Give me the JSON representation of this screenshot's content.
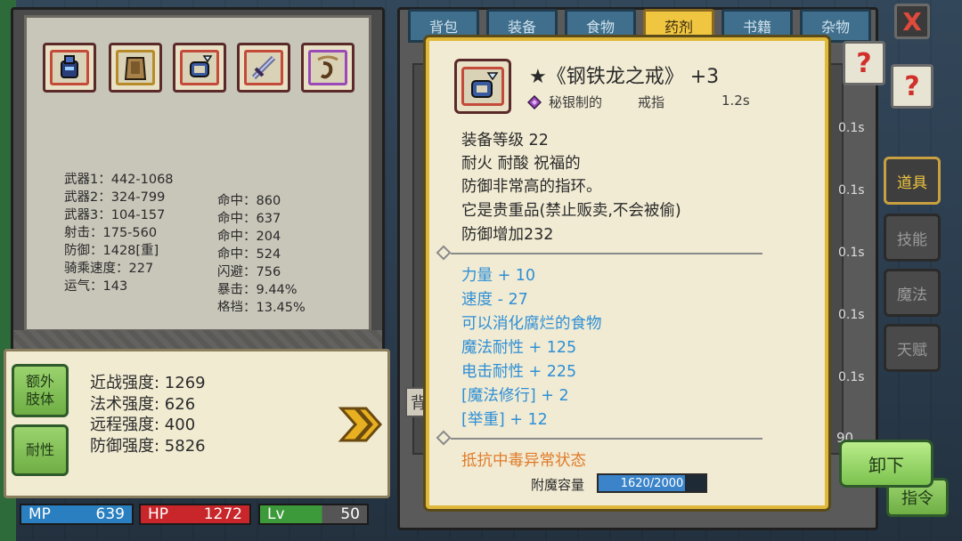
{
  "tabs": [
    "背包",
    "装备",
    "食物",
    "药剂",
    "书籍",
    "杂物"
  ],
  "active_tab": "药剂",
  "right_tabs": [
    "道具",
    "技能",
    "魔法",
    "天赋"
  ],
  "stats_left": [
    "武器1：442-1068",
    "武器2：324-799",
    "武器3：104-157",
    "射击：175-560",
    "防御：1428[重]",
    "骑乘速度：227",
    "运气：143"
  ],
  "stats_right": [
    "命中：860",
    "命中：637",
    "命中：204",
    "命中：524",
    "闪避：756",
    "暴击：9.44%",
    "格挡：13.45%"
  ],
  "summary": {
    "extra_limb_label": "额外\n肢体",
    "resistance_label": "耐性",
    "lines": [
      "近战强度: 1269",
      "法术强度: 626",
      "远程强度: 400",
      "防御强度: 5826"
    ]
  },
  "bars": {
    "mp_label": "MP",
    "mp_value": "639",
    "hp_label": "HP",
    "hp_value": "1272",
    "lv_label": "Lv",
    "lv_value": "50"
  },
  "item": {
    "title": "★《钢铁龙之戒》 +3",
    "material": "秘银制的",
    "type": "戒指",
    "time": "1.2s",
    "description": [
      "装备等级 22",
      "耐火  耐酸  祝福的",
      "防御非常高的指环。",
      "它是贵重品(禁止贩卖,不会被偷)",
      "防御增加232"
    ],
    "bonuses": [
      "力量 + 10",
      "速度 - 27",
      "可以消化腐烂的食物",
      "魔法耐性 + 125",
      "电击耐性 + 225",
      "[魔法修行] + 2",
      "[举重] + 12"
    ],
    "special": "抵抗中毒异常状态",
    "enchant_label": "附魔容量",
    "enchant_value": "1620/2000",
    "enchant_fraction": 0.81
  },
  "unequip_label": "卸下",
  "hidden_partial": {
    "side_times": [
      "0.1s",
      "0.1s",
      "0.1s",
      "0.1s",
      "0.1s",
      "0.1s"
    ],
    "behind_tooltip_label": "背",
    "bottom_right_label": "指令",
    "right_number": "90"
  },
  "help_mark": "?",
  "close_mark": "X",
  "colors": {
    "mp": "#2a7fc0",
    "hp": "#c8262a",
    "lv": "#3d9a3a",
    "tooltip_border": "#e0b83a",
    "bonus_text": "#2f8fd6",
    "special_text": "#e07b2a"
  }
}
